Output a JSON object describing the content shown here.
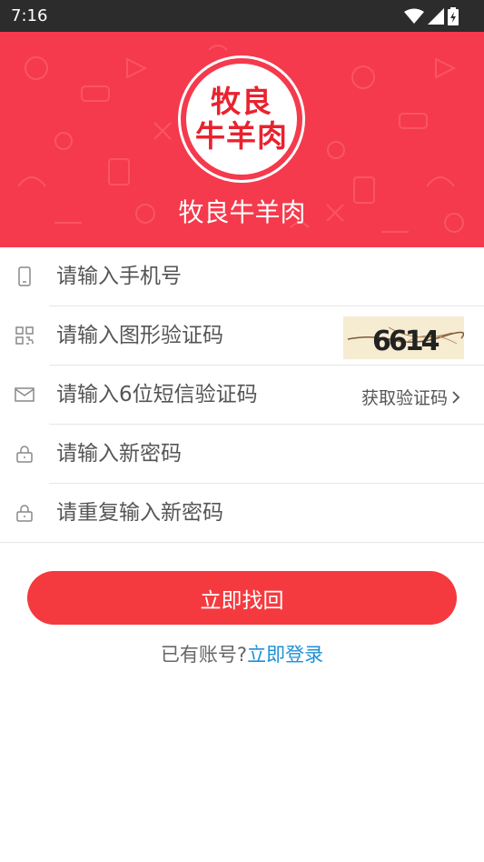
{
  "status": {
    "time": "7:16"
  },
  "header": {
    "logo_line1": "牧良",
    "logo_line2": "牛羊肉",
    "brand_name": "牧良牛羊肉"
  },
  "form": {
    "phone_placeholder": "请输入手机号",
    "captcha_placeholder": "请输入图形验证码",
    "captcha_image_text": "6614",
    "sms_placeholder": "请输入6位短信验证码",
    "get_code_label": "获取验证码",
    "new_password_placeholder": "请输入新密码",
    "repeat_password_placeholder": "请重复输入新密码"
  },
  "actions": {
    "submit_label": "立即找回",
    "login_prompt": "已有账号?",
    "login_link": "立即登录"
  },
  "colors": {
    "brand_red": "#f53a4d",
    "button_red": "#f53a3f",
    "link_blue": "#1e90d6"
  }
}
